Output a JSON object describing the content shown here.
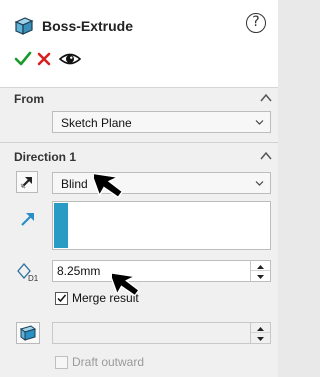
{
  "header": {
    "title": "Boss-Extrude",
    "help_label": "?",
    "ok_icon": "checkmark-icon",
    "cancel_icon": "x-icon",
    "preview_icon": "eye-icon"
  },
  "from": {
    "title": "From",
    "selected": "Sketch Plane"
  },
  "direction1": {
    "title": "Direction 1",
    "end_condition": "Blind",
    "depth": "8.25mm",
    "merge_result_label": "Merge result",
    "merge_result_checked": true
  },
  "draft": {
    "value": "",
    "draft_outward_label": "Draft outward",
    "draft_outward_checked": false
  },
  "colors": {
    "accent": "#2a9bc4",
    "ok": "#1a9a2a",
    "cancel": "#d62020"
  }
}
